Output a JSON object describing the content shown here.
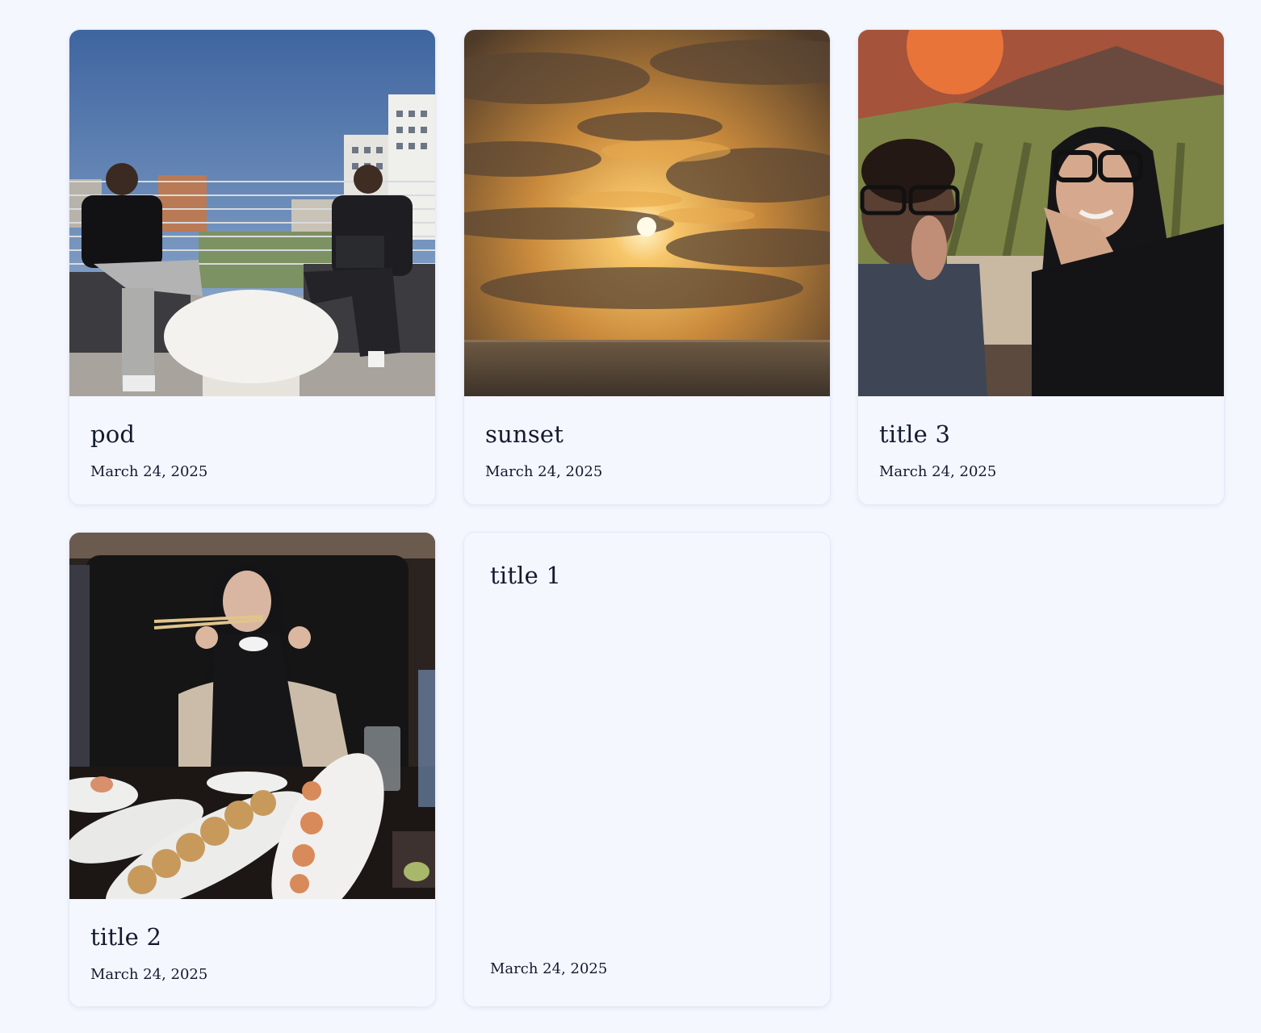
{
  "cards": [
    {
      "title": "pod",
      "date": "March 24, 2025",
      "image": "rooftop-two-friends-photo"
    },
    {
      "title": "sunset",
      "date": "March 24, 2025",
      "image": "ocean-sunset-photo"
    },
    {
      "title": "title 3",
      "date": "March 24, 2025",
      "image": "selfie-mural-photo"
    },
    {
      "title": "title 2",
      "date": "March 24, 2025",
      "image": "sushi-dinner-photo"
    },
    {
      "title": "title 1",
      "date": "March 24, 2025"
    }
  ],
  "colors": {
    "page_background": "#f4f7fe",
    "card_background": "#f4f7fe",
    "text": "#141a2e"
  }
}
